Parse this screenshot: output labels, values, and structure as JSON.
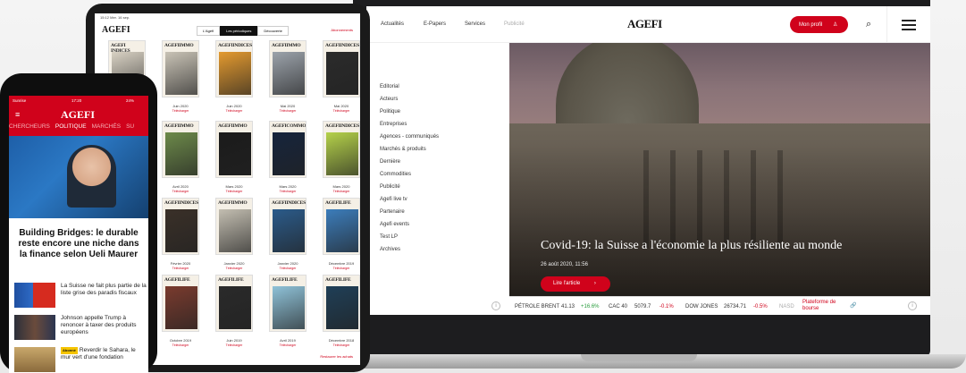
{
  "laptop": {
    "nav": {
      "items": [
        "Actualités",
        "E-Papers",
        "Services",
        "Publicité"
      ],
      "logo": "AGEFI",
      "profile_label": "Mon profil",
      "search_icon": "⌕"
    },
    "sidebar": [
      "Editorial",
      "Acteurs",
      "Politique",
      "Entreprises",
      "Agences - communiqués",
      "Marchés & produits",
      "Dernière",
      "Commodities",
      "Publicité",
      "Agefi live tv",
      "Partenaire",
      "Agefi events",
      "Test LP",
      "Archives"
    ],
    "hero": {
      "title": "Covid-19: la Suisse a l'économie la plus résiliente au monde",
      "date": "26 août 2020, 11:56",
      "button": "Lire l'article"
    },
    "ticker": {
      "items": [
        {
          "name": "PÉTROLE BRENT",
          "value": "41.13",
          "change": "+16.6%",
          "dir": "pos"
        },
        {
          "name": "CAC 40",
          "value": "5079.7",
          "change": "-0.1%",
          "dir": "neg"
        },
        {
          "name": "DOW JONES",
          "value": "26734.71",
          "change": "-0.5%",
          "dir": "neg"
        },
        {
          "name": "NASD",
          "value": "",
          "change": "",
          "dir": ""
        }
      ],
      "platform": "Plateforme de bourse"
    },
    "icons": {
      "info": "i",
      "link": "🔗"
    }
  },
  "tablet": {
    "status": "15:12  Mer. 16 sep.",
    "logo": "AGEFI",
    "tabs": [
      "L'Agefi",
      "Les périodiques",
      "Découverte"
    ],
    "subscriptions": "Abonnements",
    "download": "Télécharger",
    "restore": "Restaurer les achats",
    "magazines": [
      {
        "head": "AGEFI INDICES",
        "date": "",
        "color": "#d9d2c4"
      },
      {
        "head": "AGEFIIMMO",
        "date": "Juin 2020",
        "color": "#c9c3b6"
      },
      {
        "head": "AGEFIINDICES",
        "date": "Juin 2020",
        "color": "#e49a2f"
      },
      {
        "head": "AGEFIIMMO",
        "date": "Mai 2020",
        "color": "#9ca3ab"
      },
      {
        "head": "AGEFIINDICES",
        "date": "Mai 2020",
        "color": "#2b2b2b"
      },
      {
        "head": "AGEFIIMMO",
        "date": "Avril 2020",
        "color": "#6d8a4a"
      },
      {
        "head": "AGEFIIMMO",
        "date": "Mars 2020",
        "color": "#1b1b1b"
      },
      {
        "head": "AGEFICOMMODITIES",
        "date": "Mars 2020",
        "color": "#16243c"
      },
      {
        "head": "AGEFIINDICES",
        "date": "Mars 2020",
        "color": "#b5d24a"
      },
      {
        "head": "AGEFIINDICES",
        "date": "Février 2020",
        "color": "#3a3028"
      },
      {
        "head": "AGEFIIMMO",
        "date": "Janvier 2020",
        "color": "#c3beb1"
      },
      {
        "head": "AGEFIINDICES",
        "date": "Janvier 2020",
        "color": "#2b5b8a"
      },
      {
        "head": "AGEFILIFE",
        "date": "Décembre 2019",
        "color": "#3c7dbb"
      },
      {
        "head": "AGEFILIFE",
        "date": "Octobre 2019",
        "color": "#7a3b2e"
      },
      {
        "head": "AGEFILIFE",
        "date": "Juin 2019",
        "color": "#2a2a2a"
      },
      {
        "head": "AGEFILIFE",
        "date": "Avril 2019",
        "color": "#8fc2d8"
      },
      {
        "head": "AGEFILIFE",
        "date": "Décembre 2018",
        "color": "#1f3f57"
      }
    ]
  },
  "phone": {
    "status": {
      "left": "Sunrise",
      "time": "17:20",
      "right": "24%"
    },
    "logo": "AGEFI",
    "menu_icon": "≡",
    "categories": [
      "CHERCHEURS",
      "POLITIQUE",
      "MARCHÉS",
      "SU"
    ],
    "active_category": "POLITIQUE",
    "headline": "Building Bridges: le durable reste encore une niche dans la finance selon Ueli Maurer",
    "articles": [
      {
        "text": "La Suisse ne fait plus partie de la liste grise des paradis fiscaux",
        "badge": ""
      },
      {
        "text": "Johnson appelle Trump à renoncer à taxer des produits européens",
        "badge": ""
      },
      {
        "text": "Reverdir le Sahara, le mur vert d'une fondation",
        "badge": "Abonné"
      }
    ]
  }
}
